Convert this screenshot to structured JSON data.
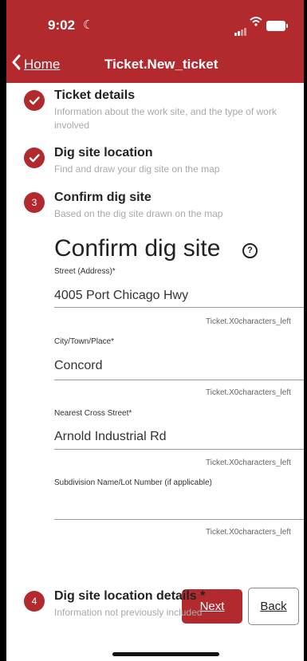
{
  "status": {
    "time": "9:02"
  },
  "nav": {
    "back_label": "Home",
    "title": "Ticket.New_ticket"
  },
  "steps": [
    {
      "number": "",
      "title": "Ticket details",
      "description": "Information about the work site, and the type of work involved",
      "state": "done"
    },
    {
      "number": "",
      "title": "Dig site location",
      "description": "Find and draw your dig site on the map",
      "state": "done"
    },
    {
      "number": "3",
      "title": "Confirm dig site",
      "description": "Based on the dig site drawn on the map",
      "state": "current"
    },
    {
      "number": "4",
      "title": "Dig site location details *",
      "description": "Information not previously included",
      "state": "upcoming"
    }
  ],
  "form": {
    "title": "Confirm dig site",
    "fields": [
      {
        "label": "Street (Address)*",
        "value": "4005 Port Chicago Hwy",
        "note": "Ticket.X0characters_left"
      },
      {
        "label": "City/Town/Place*",
        "value": "Concord",
        "note": "Ticket.X0characters_left"
      },
      {
        "label": "Nearest Cross Street*",
        "value": "Arnold Industrial Rd",
        "note": "Ticket.X0characters_left"
      },
      {
        "label": "Subdivision Name/Lot Number (if applicable)",
        "value": "",
        "note": "Ticket.X0characters_left"
      }
    ],
    "next_label": "Next",
    "back_label": "Back"
  },
  "icons": {
    "check": "check-icon",
    "help": "help-circle-icon",
    "back": "chevron-left-icon"
  },
  "colors": {
    "brand": "#b32a2e"
  }
}
